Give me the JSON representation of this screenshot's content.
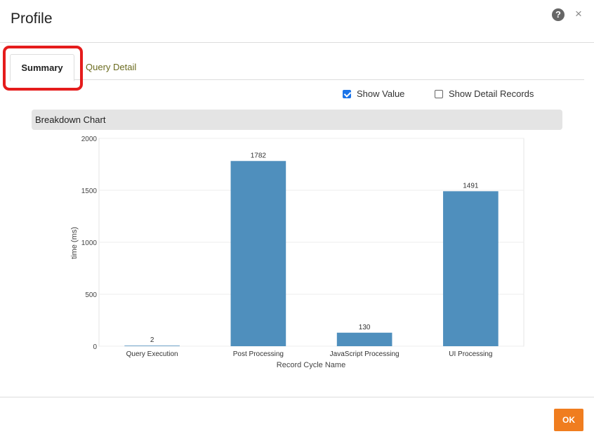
{
  "dialog": {
    "title": "Profile",
    "help_icon": "question-circle-icon",
    "close_icon": "close-icon",
    "help_glyph": "?",
    "close_glyph": "×"
  },
  "tabs": [
    {
      "label": "Summary",
      "active": true
    },
    {
      "label": "Query Detail",
      "active": false
    }
  ],
  "options": {
    "show_value": {
      "label": "Show Value",
      "checked": true
    },
    "show_detail_records": {
      "label": "Show Detail Records",
      "checked": false
    }
  },
  "section": {
    "title": "Breakdown Chart"
  },
  "chart_data": {
    "type": "bar",
    "categories": [
      "Query Execution",
      "Post Processing",
      "JavaScript Processing",
      "UI Processing"
    ],
    "values": [
      2,
      1782,
      130,
      1491
    ],
    "xlabel": "Record Cycle Name",
    "ylabel": "time (ms)",
    "ylim": [
      0,
      2000
    ],
    "yticks": [
      0,
      500,
      1000,
      1500,
      2000
    ],
    "show_values": true,
    "grid": true,
    "bar_color": "#4f8fbd"
  },
  "footer": {
    "ok_label": "OK",
    "accent_color": "#f07d1f"
  }
}
